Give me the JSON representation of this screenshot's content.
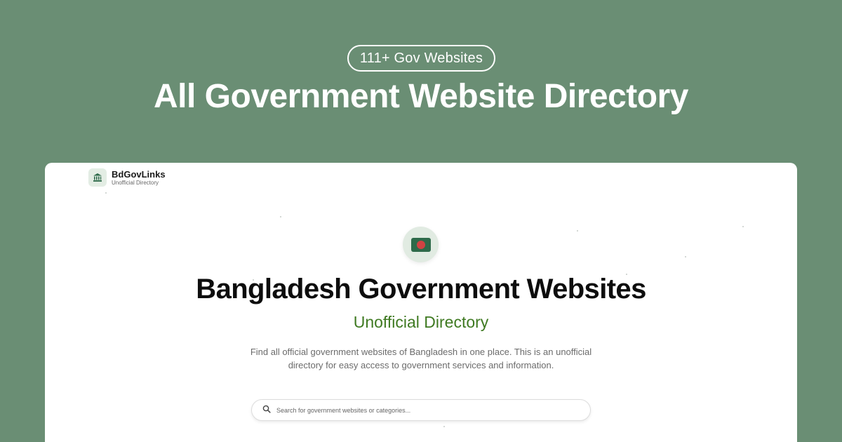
{
  "banner": {
    "badge": "111+ Gov Websites",
    "title": "All Government Website Directory"
  },
  "brand": {
    "name": "BdGovLinks",
    "tagline": "Unofficial Directory",
    "icon": "bank-building-icon"
  },
  "hero": {
    "flag_icon": "bangladesh-flag-icon",
    "title": "Bangladesh Government Websites",
    "subtitle": "Unofficial Directory",
    "description": "Find all official government websites of Bangladesh in one place. This is an unofficial directory for easy access to government services and information."
  },
  "search": {
    "icon": "search-icon",
    "placeholder": "Search for government websites or categories...",
    "value": ""
  },
  "colors": {
    "background": "#6a8e74",
    "accent_green": "#3f7a22",
    "flag_green": "#2e6a4a",
    "flag_red": "#d04343"
  }
}
